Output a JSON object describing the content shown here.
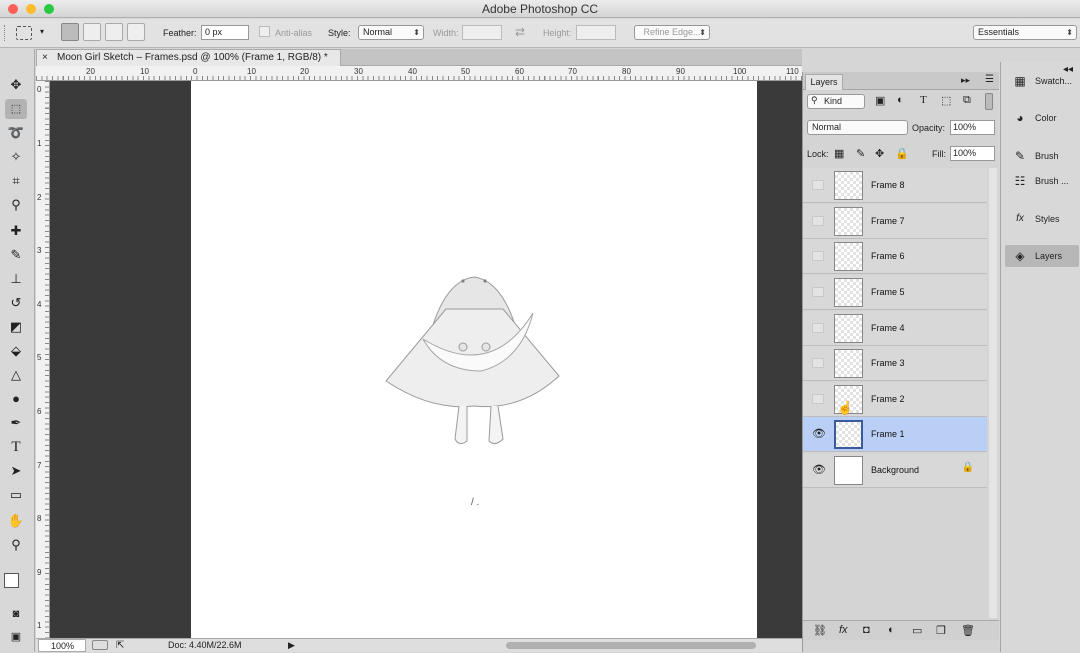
{
  "app": {
    "title": "Adobe Photoshop CC"
  },
  "options_bar": {
    "feather_label": "Feather:",
    "feather_value": "0 px",
    "antialias_label": "Anti-alias",
    "style_label": "Style:",
    "style_value": "Normal",
    "width_label": "Width:",
    "height_label": "Height:",
    "refine_edge_label": "Refine Edge...",
    "workspace_value": "Essentials"
  },
  "document": {
    "tab_title": "Moon Girl Sketch – Frames.psd @ 100% (Frame 1, RGB/8) *",
    "canvas_text": "/ ."
  },
  "rulers": {
    "horizontal_ticks": [
      "20",
      "10",
      "0",
      "10",
      "20",
      "30",
      "40",
      "50",
      "60",
      "70",
      "80",
      "90",
      "100",
      "110"
    ],
    "vertical_ticks": [
      "0",
      "1",
      "2",
      "3",
      "4",
      "5",
      "6",
      "7",
      "8",
      "9",
      "1"
    ]
  },
  "status_bar": {
    "zoom": "100%",
    "doc_info": "Doc: 4.40M/22.6M"
  },
  "layers_panel": {
    "tab_label": "Layers",
    "filter_kind": "Kind",
    "blend_mode": "Normal",
    "opacity_label": "Opacity:",
    "opacity_value": "100%",
    "lock_label": "Lock:",
    "fill_label": "Fill:",
    "fill_value": "100%",
    "layers": [
      {
        "name": "Frame 8",
        "visible": false,
        "selected": false
      },
      {
        "name": "Frame 7",
        "visible": false,
        "selected": false
      },
      {
        "name": "Frame 6",
        "visible": false,
        "selected": false
      },
      {
        "name": "Frame 5",
        "visible": false,
        "selected": false
      },
      {
        "name": "Frame 4",
        "visible": false,
        "selected": false
      },
      {
        "name": "Frame 3",
        "visible": false,
        "selected": false
      },
      {
        "name": "Frame 2",
        "visible": false,
        "selected": false
      },
      {
        "name": "Frame 1",
        "visible": true,
        "selected": true
      },
      {
        "name": "Background",
        "visible": true,
        "selected": false,
        "locked": true
      }
    ]
  },
  "dock": {
    "items": [
      {
        "label": "Swatch...",
        "icon": "swatches-icon"
      },
      {
        "label": "Color",
        "icon": "color-icon"
      },
      {
        "label": "Brush",
        "icon": "brush-icon"
      },
      {
        "label": "Brush ...",
        "icon": "brush-presets-icon"
      },
      {
        "label": "Styles",
        "icon": "styles-icon"
      },
      {
        "label": "Layers",
        "icon": "layers-icon",
        "selected": true
      }
    ]
  }
}
